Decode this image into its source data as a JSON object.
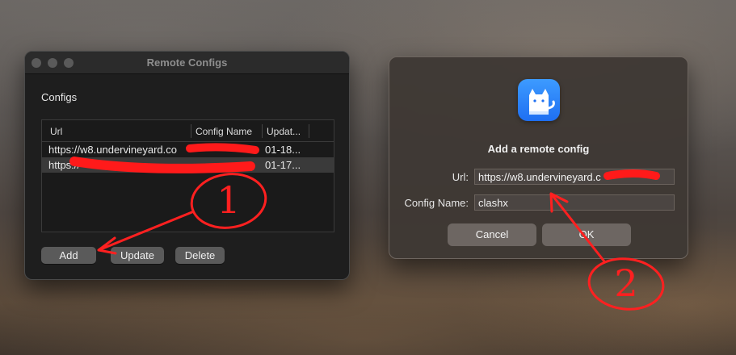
{
  "left_window": {
    "title": "Remote Configs",
    "section_label": "Configs",
    "columns": [
      "Url",
      "Config Name",
      "Updat..."
    ],
    "rows": [
      {
        "url": "https://w8.undervineyard.co",
        "date": "01-18..."
      },
      {
        "url": "https://",
        "date": "01-17..."
      }
    ],
    "buttons": {
      "add": "Add",
      "update": "Update",
      "delete": "Delete"
    }
  },
  "right_window": {
    "title": "Add a remote config",
    "url_label": "Url:",
    "url_value": "https://w8.undervineyard.c",
    "name_label": "Config Name:",
    "name_value": "clashx",
    "cancel": "Cancel",
    "ok": "OK"
  },
  "annotations": {
    "step1": "1",
    "step2": "2",
    "color": "#ff2020"
  },
  "colors": {
    "icon_blue": "#2a84ff",
    "redaction": "#ff1a1a"
  }
}
